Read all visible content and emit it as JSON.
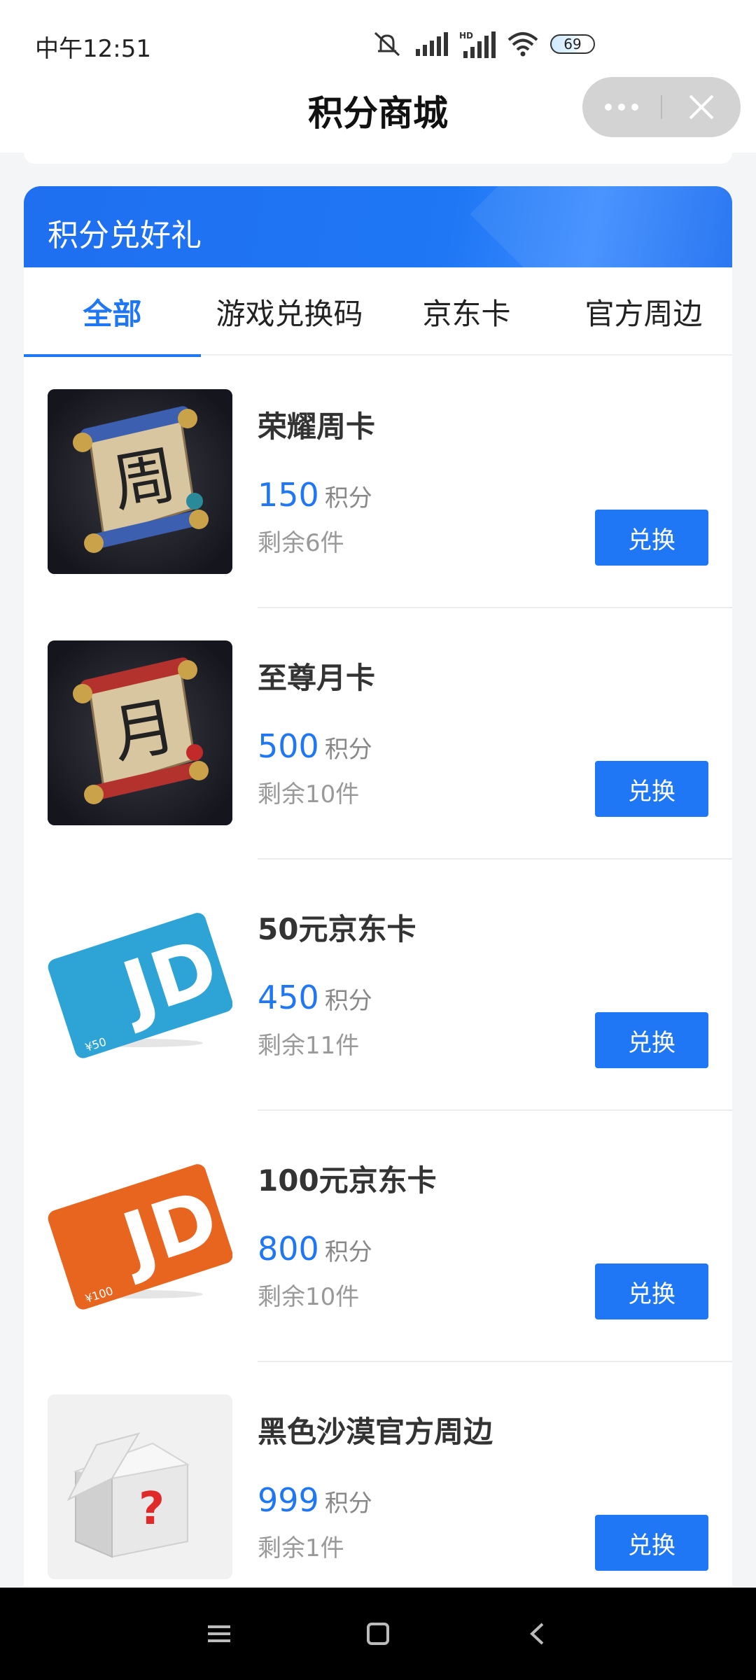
{
  "status": {
    "time": "中午12:51",
    "battery": "69",
    "network_label": "HD"
  },
  "titlebar": {
    "title": "积分商城"
  },
  "banner": {
    "title": "积分兑好礼"
  },
  "tabs": [
    {
      "label": "全部",
      "active": true
    },
    {
      "label": "游戏兑换码",
      "active": false
    },
    {
      "label": "京东卡",
      "active": false
    },
    {
      "label": "官方周边",
      "active": false
    }
  ],
  "points_unit": "积分",
  "items": [
    {
      "name": "荣耀周卡",
      "points": "150",
      "stock": "剩余6件",
      "button": "兑换",
      "icon": "week-scroll-icon",
      "glyph": "周"
    },
    {
      "name": "至尊月卡",
      "points": "500",
      "stock": "剩余10件",
      "button": "兑换",
      "icon": "month-scroll-icon",
      "glyph": "月"
    },
    {
      "name": "50元京东卡",
      "points": "450",
      "stock": "剩余11件",
      "button": "兑换",
      "icon": "jd-card-blue-icon",
      "glyph": "¥50"
    },
    {
      "name": "100元京东卡",
      "points": "800",
      "stock": "剩余10件",
      "button": "兑换",
      "icon": "jd-card-orange-icon",
      "glyph": "¥100"
    },
    {
      "name": "黑色沙漠官方周边",
      "points": "999",
      "stock": "剩余1件",
      "button": "兑换",
      "icon": "mystery-box-icon",
      "glyph": "?"
    }
  ],
  "colors": {
    "accent": "#1f77f5",
    "jd_blue": "#2ea4d6",
    "jd_orange": "#e8651f"
  }
}
